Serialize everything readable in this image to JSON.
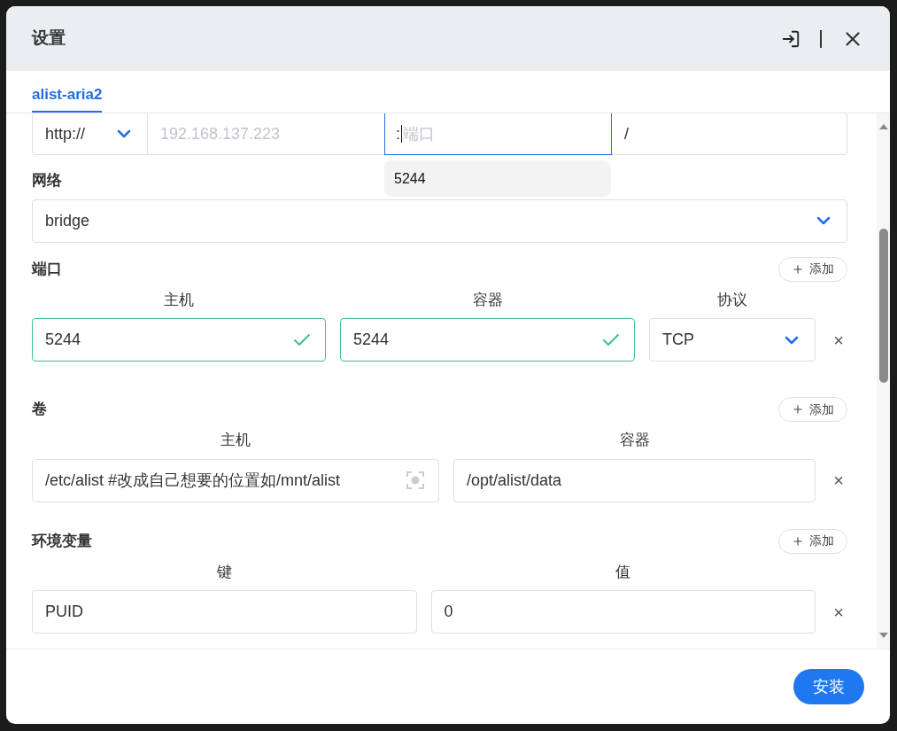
{
  "dialog": {
    "title": "设置"
  },
  "tabs": [
    {
      "label": "alist-aria2",
      "selected": true
    }
  ],
  "url": {
    "scheme": "http://",
    "host_placeholder": "192.168.137.223",
    "port_prefix": ":",
    "port_placeholder": "端口",
    "path": "/",
    "suggestion": "5244"
  },
  "network": {
    "label": "网络",
    "value": "bridge"
  },
  "ports": {
    "label": "端口",
    "add": "添加",
    "columns": [
      "主机",
      "容器",
      "协议"
    ],
    "rows": [
      {
        "host": "5244",
        "host_valid": true,
        "container": "5244",
        "container_valid": true,
        "protocol": "TCP",
        "remove": "×"
      }
    ]
  },
  "volumes": {
    "label": "卷",
    "add": "添加",
    "columns": [
      "主机",
      "容器"
    ],
    "rows": [
      {
        "host": "/etc/alist #改成自己想要的位置如/mnt/alist",
        "container": "/opt/alist/data",
        "remove": "×"
      }
    ]
  },
  "env": {
    "label": "环境变量",
    "add": "添加",
    "columns": [
      "键",
      "值"
    ],
    "rows": [
      {
        "key": "PUID",
        "value": "0",
        "remove": "×"
      }
    ]
  },
  "footer": {
    "install": "安装"
  }
}
